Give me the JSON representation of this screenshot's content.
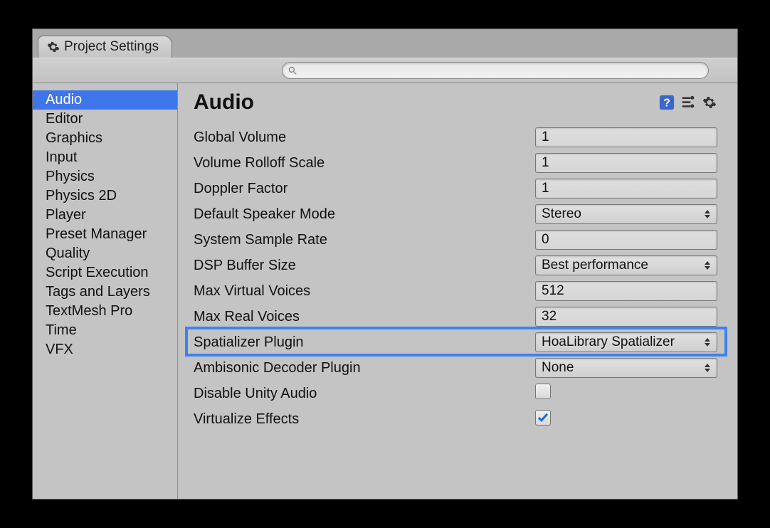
{
  "tab_title": "Project Settings",
  "sidebar": {
    "items": [
      {
        "label": "Audio",
        "selected": true
      },
      {
        "label": "Editor",
        "selected": false
      },
      {
        "label": "Graphics",
        "selected": false
      },
      {
        "label": "Input",
        "selected": false
      },
      {
        "label": "Physics",
        "selected": false
      },
      {
        "label": "Physics 2D",
        "selected": false
      },
      {
        "label": "Player",
        "selected": false
      },
      {
        "label": "Preset Manager",
        "selected": false
      },
      {
        "label": "Quality",
        "selected": false
      },
      {
        "label": "Script Execution",
        "selected": false
      },
      {
        "label": "Tags and Layers",
        "selected": false
      },
      {
        "label": "TextMesh Pro",
        "selected": false
      },
      {
        "label": "Time",
        "selected": false
      },
      {
        "label": "VFX",
        "selected": false
      }
    ]
  },
  "main": {
    "title": "Audio",
    "fields": [
      {
        "label": "Global Volume",
        "type": "text",
        "value": "1"
      },
      {
        "label": "Volume Rolloff Scale",
        "type": "text",
        "value": "1"
      },
      {
        "label": "Doppler Factor",
        "type": "text",
        "value": "1"
      },
      {
        "label": "Default Speaker Mode",
        "type": "dropdown",
        "value": "Stereo"
      },
      {
        "label": "System Sample Rate",
        "type": "text",
        "value": "0"
      },
      {
        "label": "DSP Buffer Size",
        "type": "dropdown",
        "value": "Best performance"
      },
      {
        "label": "Max Virtual Voices",
        "type": "text",
        "value": "512"
      },
      {
        "label": "Max Real Voices",
        "type": "text",
        "value": "32"
      },
      {
        "label": "Spatializer Plugin",
        "type": "dropdown",
        "value": "HoaLibrary Spatializer"
      },
      {
        "label": "Ambisonic Decoder Plugin",
        "type": "dropdown",
        "value": "None"
      },
      {
        "label": "Disable Unity Audio",
        "type": "checkbox",
        "value": false
      },
      {
        "label": "Virtualize Effects",
        "type": "checkbox",
        "value": true
      }
    ],
    "highlight_field_index": 8
  }
}
